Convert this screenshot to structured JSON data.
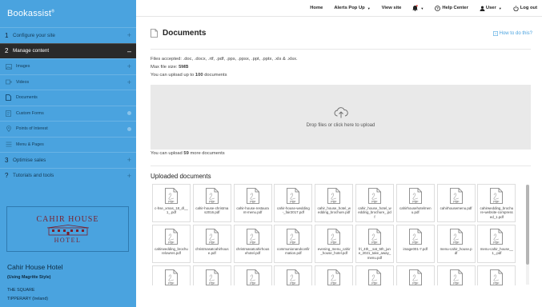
{
  "sidebar": {
    "logo": "Bookassist",
    "logo_mark": "®",
    "items": [
      {
        "num": "1",
        "label": "Configure your site",
        "action": "+"
      },
      {
        "num": "2",
        "label": "Manage content",
        "action": "–",
        "active": true
      },
      {
        "label": "Images",
        "icon": "image-icon",
        "action": "+"
      },
      {
        "label": "Videos",
        "icon": "video-icon",
        "action": "+"
      },
      {
        "label": "Documents",
        "icon": "document-icon"
      },
      {
        "label": "Custom Forms",
        "icon": "form-icon"
      },
      {
        "label": "Points of Interest",
        "icon": "map-pin-icon"
      },
      {
        "label": "Menu & Pages",
        "icon": "menu-icon"
      },
      {
        "num": "3",
        "label": "Optimise sales",
        "action": "+"
      },
      {
        "num": "?",
        "label": "Tutorials and tools",
        "action": "+"
      }
    ],
    "hotel_card": {
      "line1": "CAHIR HOUSE",
      "line2": "HOTEL"
    },
    "hotel_name": "Cahir House Hotel",
    "hotel_style": "(Using Magritte Style)",
    "address_line1": "THE SQUARE",
    "address_line2": "TIPPERARY (Ireland)"
  },
  "topbar": {
    "home": "Home",
    "alerts": "Alerts Pop Up",
    "view_site": "View site",
    "help": "Help Center",
    "user": "User",
    "logout": "Log out"
  },
  "main": {
    "title": "Documents",
    "howto": "How to do this?",
    "files_accepted": "Files accepted: .doc, .docx, .rtf, .pdf, .pps, .ppsx, .ppt, .pptx, .xls & .xlsx.",
    "max_size_label": "Max file size:",
    "max_size_value": "5MB",
    "upload_limit_prefix": "You can upload up to",
    "upload_limit_value": "100",
    "upload_limit_suffix": "documents",
    "dropzone_text": "Drop files or click here to upload",
    "remaining_prefix": "You can upload",
    "remaining_value": "59",
    "remaining_suffix": "more documents",
    "uploaded_title": "Uploaded documents",
    "file_badge": "PDF",
    "files": [
      "c-hse_xmas_18_dl__1_.pdf",
      "cahir-house-christmas2016.pdf",
      "cahir-house-restaurant-menu.pdf",
      "cahir-house-wedding-_fair2017.pdf",
      "cahir_house_hotel_wedding_brochure.pdf",
      "cahir_house_hotel_wedding_brochure_.pdf",
      "cahirhousehotelmenu.pdf",
      "cahirhousemenu.pdf",
      "cahirwedding_brochure-website-compressed_1.pdf",
      "cahirwedding_brochurelowres.pdf",
      "christmasatcahirhouse.pdf",
      "christmasatcahirhousehotel.pdf",
      "communionandconfirmation.pdf",
      "evening_menu_cahir_house_hotel.pdf",
      "fri_4th__sat_5th_june_2021_take_away_menu.pdf",
      "image001-7.pdf",
      "menu-cahir_house.pdf",
      "menu-cahir_house__1_.pdf",
      "",
      "",
      "",
      "",
      "",
      "",
      "",
      "",
      ""
    ]
  }
}
